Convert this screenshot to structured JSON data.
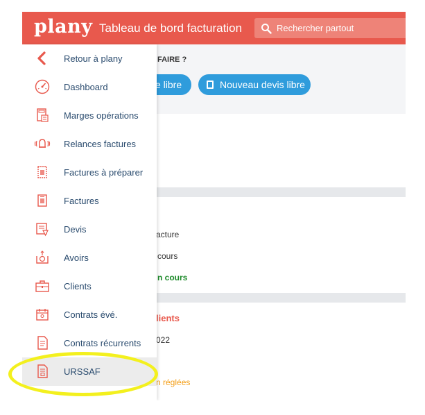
{
  "header": {
    "logo": "plany",
    "title": "Tableau de bord facturation",
    "search_placeholder": "Rechercher partout",
    "brand_color": "#e8594d"
  },
  "sidebar": {
    "items": [
      {
        "label": "Retour à plany",
        "icon": "chevron-left-icon"
      },
      {
        "label": "Dashboard",
        "icon": "gauge-icon"
      },
      {
        "label": "Marges opérations",
        "icon": "calculator-icon"
      },
      {
        "label": "Relances factures",
        "icon": "bell-ringing-icon"
      },
      {
        "label": "Factures à préparer",
        "icon": "invoice-draft-icon"
      },
      {
        "label": "Factures",
        "icon": "invoice-icon"
      },
      {
        "label": "Devis",
        "icon": "quote-document-icon"
      },
      {
        "label": "Avoirs",
        "icon": "credit-note-icon"
      },
      {
        "label": "Clients",
        "icon": "briefcase-icon"
      },
      {
        "label": "Contrats évé.",
        "icon": "event-contract-icon"
      },
      {
        "label": "Contrats récurrents",
        "icon": "recurring-contract-icon"
      },
      {
        "label": "URSSAF",
        "icon": "urssaf-document-icon",
        "active": true
      }
    ]
  },
  "main": {
    "quick_title": "FAIRE ?",
    "buttons": [
      "e libre",
      "Nouveau devis libre"
    ],
    "lines": [
      "acture",
      "cours",
      "n cours",
      "lients",
      "022",
      "n réglées"
    ]
  },
  "highlight_color": "#f3f01e"
}
